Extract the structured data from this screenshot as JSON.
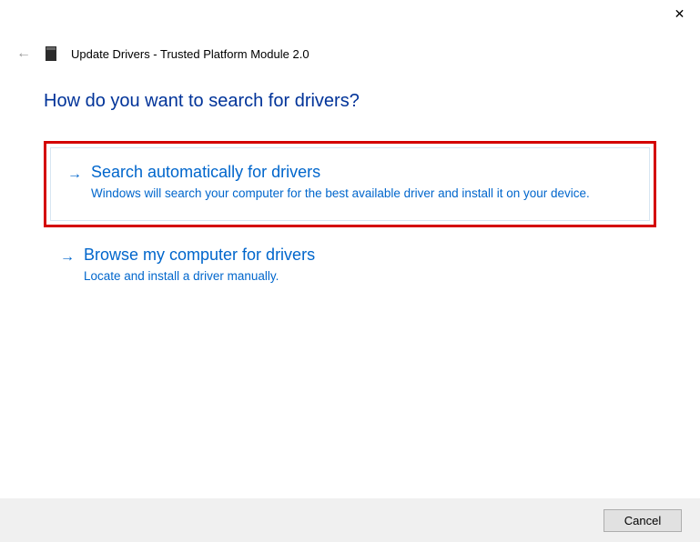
{
  "titlebar": {
    "close_symbol": "✕"
  },
  "nav": {
    "back_symbol": "←",
    "wizard_title": "Update Drivers - Trusted Platform Module 2.0"
  },
  "main": {
    "question": "How do you want to search for drivers?",
    "options": [
      {
        "arrow": "→",
        "title": "Search automatically for drivers",
        "desc": "Windows will search your computer for the best available driver and install it on your device."
      },
      {
        "arrow": "→",
        "title": "Browse my computer for drivers",
        "desc": "Locate and install a driver manually."
      }
    ]
  },
  "footer": {
    "cancel_label": "Cancel"
  }
}
